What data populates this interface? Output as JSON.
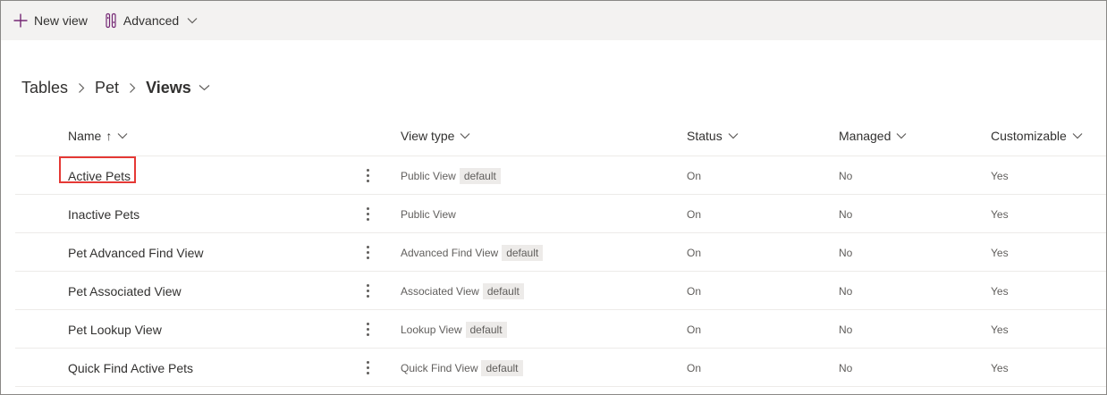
{
  "toolbar": {
    "new_view_label": "New view",
    "advanced_label": "Advanced"
  },
  "breadcrumb": {
    "items": [
      "Tables",
      "Pet"
    ],
    "current": "Views"
  },
  "columns": {
    "name": "Name",
    "sort_arrow": "↑",
    "view_type": "View type",
    "status": "Status",
    "managed": "Managed",
    "customizable": "Customizable"
  },
  "rows": [
    {
      "name": "Active Pets",
      "view_type": "Public View",
      "badge": "default",
      "status": "On",
      "managed": "No",
      "customizable": "Yes",
      "highlighted": true
    },
    {
      "name": "Inactive Pets",
      "view_type": "Public View",
      "badge": "",
      "status": "On",
      "managed": "No",
      "customizable": "Yes"
    },
    {
      "name": "Pet Advanced Find View",
      "view_type": "Advanced Find View",
      "badge": "default",
      "status": "On",
      "managed": "No",
      "customizable": "Yes"
    },
    {
      "name": "Pet Associated View",
      "view_type": "Associated View",
      "badge": "default",
      "status": "On",
      "managed": "No",
      "customizable": "Yes"
    },
    {
      "name": "Pet Lookup View",
      "view_type": "Lookup View",
      "badge": "default",
      "status": "On",
      "managed": "No",
      "customizable": "Yes"
    },
    {
      "name": "Quick Find Active Pets",
      "view_type": "Quick Find View",
      "badge": "default",
      "status": "On",
      "managed": "No",
      "customizable": "Yes"
    }
  ],
  "colors": {
    "accent_purple": "#742774",
    "highlight_red": "#e53935",
    "command_bar_bg": "#f3f2f1"
  },
  "icons": {
    "new": "plus-icon",
    "advanced": "advanced-icon",
    "chevron": "chevron-down-icon",
    "more": "more-vertical-icon"
  }
}
